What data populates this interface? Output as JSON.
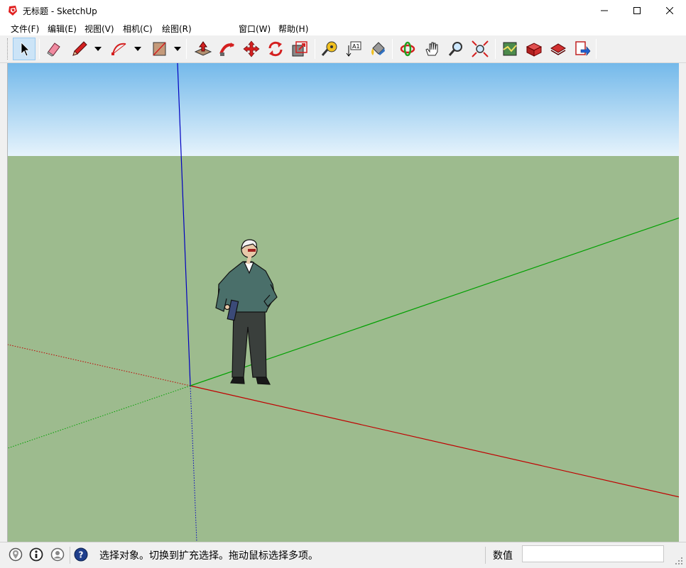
{
  "window": {
    "title": "无标题 - SketchUp",
    "app_icon": "sketchup-logo-icon",
    "controls": [
      "minimize-icon",
      "maximize-icon",
      "close-icon"
    ]
  },
  "menu": {
    "file": "文件(F)",
    "edit": "编辑(E)",
    "view": "视图(V)",
    "camera": "相机(C)",
    "draw": "绘图(R)",
    "window": "窗口(W)",
    "help": "帮助(H)"
  },
  "toolbar": {
    "tools": [
      "select-icon",
      "eraser-icon",
      "pencil-icon",
      "arc-icon",
      "rectangle-icon",
      "push-pull-icon",
      "follow-me-icon",
      "move-icon",
      "rotate-icon",
      "scale-icon",
      "tape-measure-icon",
      "text-icon",
      "paint-bucket-icon",
      "orbit-icon",
      "pan-icon",
      "zoom-icon",
      "zoom-extents-icon",
      "3d-warehouse-icon",
      "extension-warehouse-icon",
      "layout-icon",
      "export-icon"
    ],
    "active_tool": "select-icon"
  },
  "scene": {
    "sky_top": "#74b9ea",
    "sky_bottom": "#e6f3fc",
    "ground": "#9dbb8e",
    "axis_red": "#c00000",
    "axis_green": "#00a000",
    "axis_blue": "#0000c0",
    "figure": "scale-figure-person"
  },
  "status": {
    "icons": [
      "geo-location-icon",
      "credits-icon",
      "user-account-icon",
      "help-icon"
    ],
    "message": "选择对象。切换到扩充选择。拖动鼠标选择多项。",
    "measurements_label": "数值",
    "measurements_value": ""
  }
}
